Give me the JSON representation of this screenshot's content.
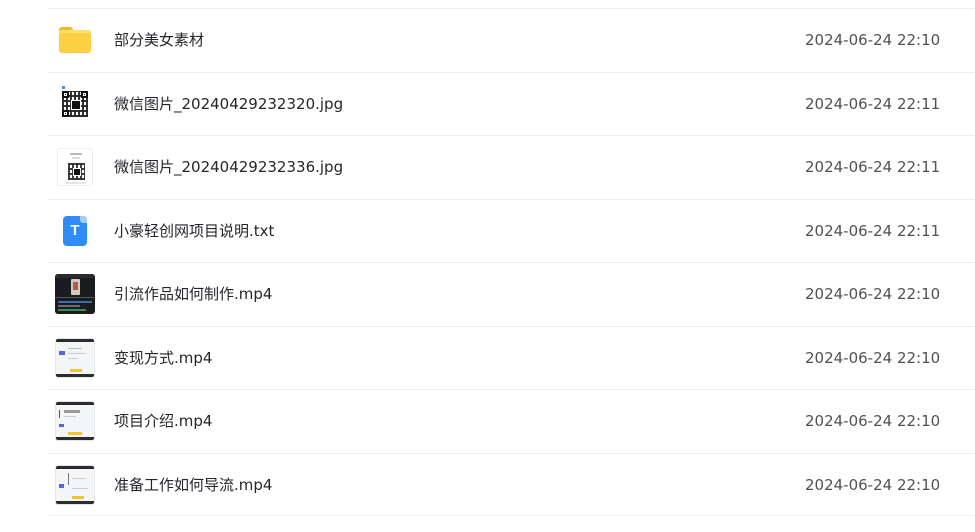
{
  "files": [
    {
      "name": "部分美女素材",
      "time": "2024-06-24 22:10",
      "icon": "folder-icon"
    },
    {
      "name": "微信图片_20240429232320.jpg",
      "time": "2024-06-24 22:11",
      "icon": "qr-image-thumbnail"
    },
    {
      "name": "微信图片_20240429232336.jpg",
      "time": "2024-06-24 22:11",
      "icon": "qr-image-thumbnail"
    },
    {
      "name": "小豪轻创网项目说明.txt",
      "time": "2024-06-24 22:11",
      "icon": "text-file-icon",
      "icon_letter": "T"
    },
    {
      "name": "引流作品如何制作.mp4",
      "time": "2024-06-24 22:10",
      "icon": "video-thumbnail"
    },
    {
      "name": "变现方式.mp4",
      "time": "2024-06-24 22:10",
      "icon": "video-thumbnail"
    },
    {
      "name": "项目介绍.mp4",
      "time": "2024-06-24 22:10",
      "icon": "video-thumbnail"
    },
    {
      "name": "准备工作如何导流.mp4",
      "time": "2024-06-24 22:10",
      "icon": "video-thumbnail"
    }
  ],
  "colors": {
    "folder": "#fdd041",
    "text_file": "#2f8cf6",
    "divider": "#eeeef0",
    "name_text": "#25262b",
    "time_text": "#505155"
  }
}
